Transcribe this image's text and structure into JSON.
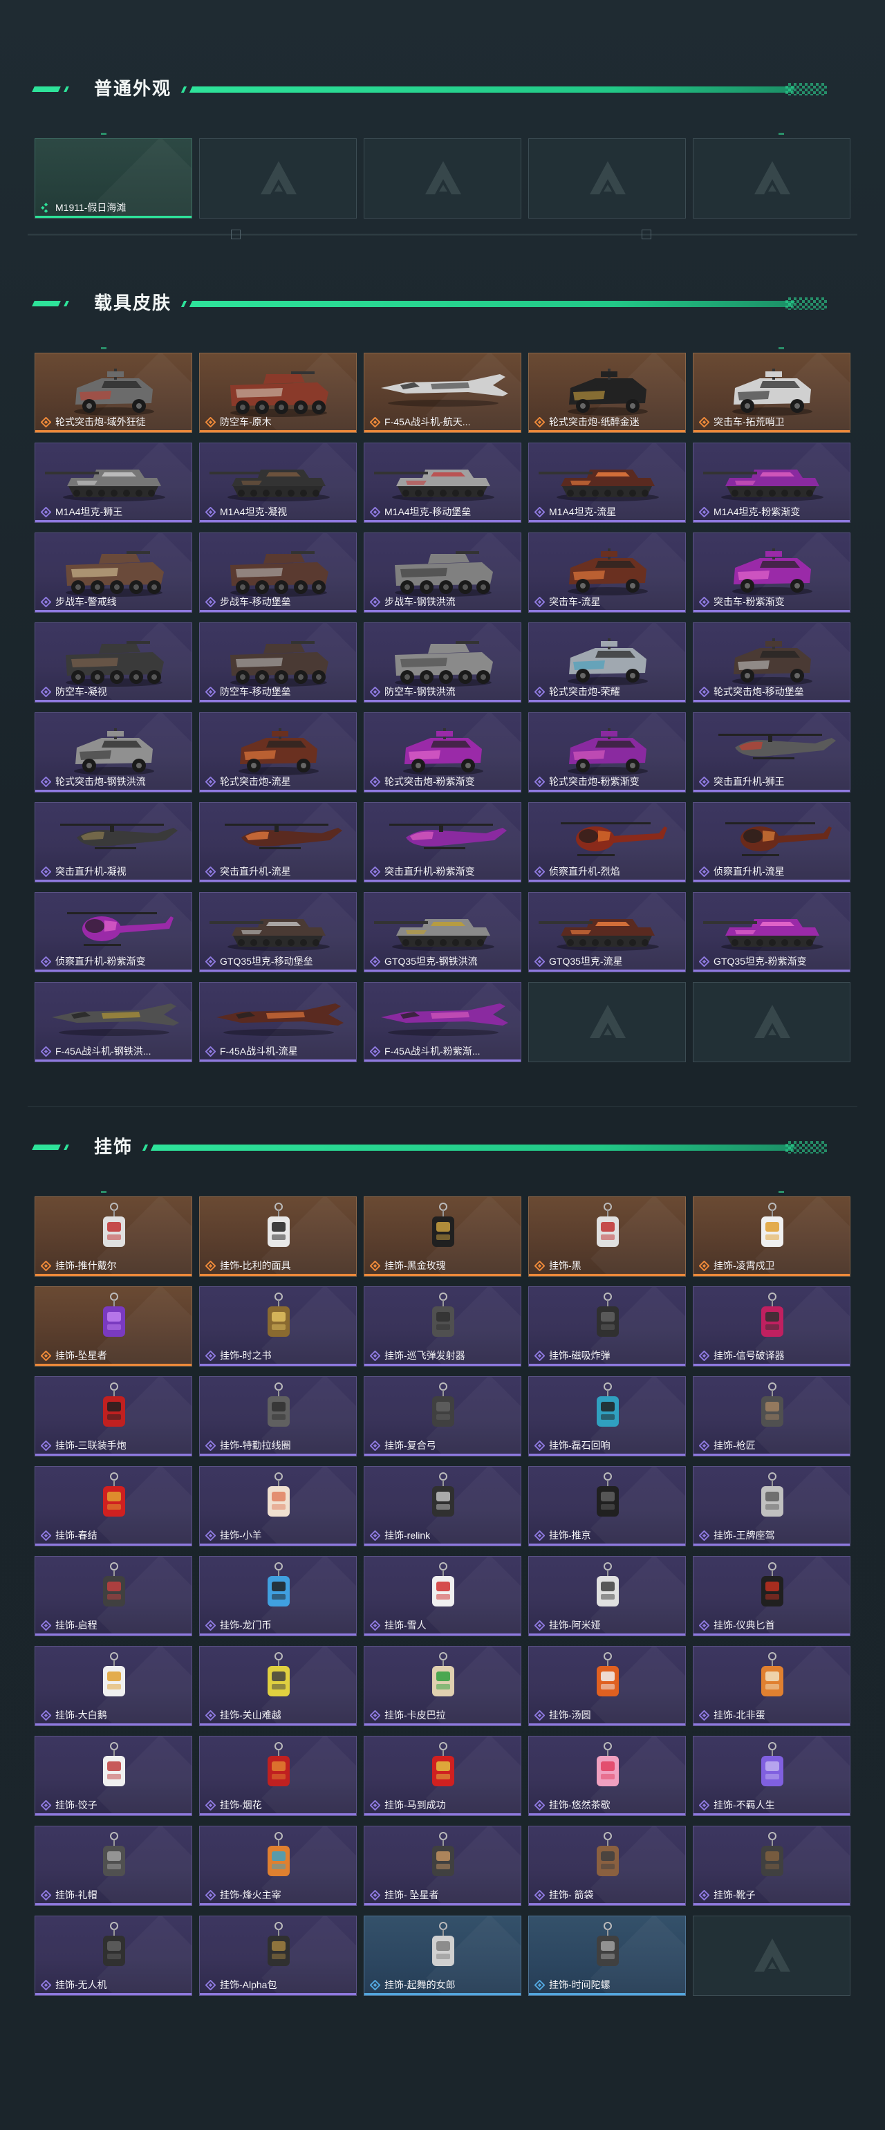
{
  "sections": [
    {
      "title": "普通外观",
      "items": [
        {
          "label": "M1911-假日海滩",
          "rarity": "green",
          "art": "pistol"
        },
        {
          "label": "",
          "rarity": "empty"
        },
        {
          "label": "",
          "rarity": "empty"
        },
        {
          "label": "",
          "rarity": "empty"
        },
        {
          "label": "",
          "rarity": "empty"
        }
      ]
    },
    {
      "title": "载具皮肤",
      "items": [
        {
          "label": "轮式突击炮-域外狂徒",
          "rarity": "orange",
          "art": "armored-car",
          "color": "#6b6b6b",
          "accent": "#c04030"
        },
        {
          "label": "防空车-原木",
          "rarity": "orange",
          "art": "apc",
          "color": "#8a3a2a",
          "accent": "#d8d0c0"
        },
        {
          "label": "F-45A战斗机-航天...",
          "rarity": "orange",
          "art": "jet",
          "color": "#d0d0d0",
          "accent": "#333333"
        },
        {
          "label": "轮式突击炮-纸醉金迷",
          "rarity": "orange",
          "art": "armored-car",
          "color": "#222222",
          "accent": "#c9a040"
        },
        {
          "label": "突击车-拓荒哨卫",
          "rarity": "orange",
          "art": "armored-car",
          "color": "#d0d0d0",
          "accent": "#222222"
        },
        {
          "label": "M1A4坦克-狮王",
          "rarity": "purple",
          "art": "tank",
          "color": "#777777",
          "accent": "#cccccc"
        },
        {
          "label": "M1A4坦克-凝视",
          "rarity": "purple",
          "art": "tank",
          "color": "#333333",
          "accent": "#7a5a40"
        },
        {
          "label": "M1A4坦克-移动堡垒",
          "rarity": "purple",
          "art": "tank",
          "color": "#a0a0a0",
          "accent": "#c04040"
        },
        {
          "label": "M1A4坦克-流星",
          "rarity": "purple",
          "art": "tank",
          "color": "#5a2a20",
          "accent": "#f08040"
        },
        {
          "label": "M1A4坦克-粉紫渐变",
          "rarity": "purple",
          "art": "tank",
          "color": "#8a2aa0",
          "accent": "#e060c0"
        },
        {
          "label": "步战车-警戒线",
          "rarity": "purple",
          "art": "apc",
          "color": "#6a4a3a",
          "accent": "#e0d0a0"
        },
        {
          "label": "步战车-移动堡垒",
          "rarity": "purple",
          "art": "apc",
          "color": "#5a3a30",
          "accent": "#c0c0c0"
        },
        {
          "label": "步战车-钢铁洪流",
          "rarity": "purple",
          "art": "apc",
          "color": "#808080",
          "accent": "#303030"
        },
        {
          "label": "突击车-流星",
          "rarity": "purple",
          "art": "armored-car",
          "color": "#6a3020",
          "accent": "#f08040"
        },
        {
          "label": "突击车-粉紫渐变",
          "rarity": "purple",
          "art": "armored-car",
          "color": "#9a2aa8",
          "accent": "#f070d0"
        },
        {
          "label": "防空车-凝视",
          "rarity": "purple",
          "art": "apc",
          "color": "#3a3a3a",
          "accent": "#8a6a50"
        },
        {
          "label": "防空车-移动堡垒",
          "rarity": "purple",
          "art": "apc",
          "color": "#4a3a34",
          "accent": "#c0c0c0"
        },
        {
          "label": "防空车-钢铁洪流",
          "rarity": "purple",
          "art": "apc",
          "color": "#8a8a8a",
          "accent": "#404040"
        },
        {
          "label": "轮式突击炮-荣耀",
          "rarity": "purple",
          "art": "armored-car",
          "color": "#a0a8b0",
          "accent": "#40a0c0"
        },
        {
          "label": "轮式突击炮-移动堡垒",
          "rarity": "purple",
          "art": "armored-car",
          "color": "#4a3a34",
          "accent": "#c0c0c0"
        },
        {
          "label": "轮式突击炮-钢铁洪流",
          "rarity": "purple",
          "art": "armored-car",
          "color": "#909090",
          "accent": "#303030"
        },
        {
          "label": "轮式突击炮-流星",
          "rarity": "purple",
          "art": "armored-car",
          "color": "#6a3020",
          "accent": "#f08040"
        },
        {
          "label": "轮式突击炮-粉紫渐变",
          "rarity": "purple",
          "art": "armored-car",
          "color": "#9a2aa8",
          "accent": "#f070d0"
        },
        {
          "label": "轮式突击炮-粉紫渐变",
          "rarity": "purple",
          "art": "armored-car",
          "color": "#8a2aa0",
          "accent": "#e060c0"
        },
        {
          "label": "突击直升机-狮王",
          "rarity": "purple",
          "art": "heli",
          "color": "#5a5a5a",
          "accent": "#c04030"
        },
        {
          "label": "突击直升机-凝视",
          "rarity": "purple",
          "art": "heli",
          "color": "#3a3a3a",
          "accent": "#8a7a50"
        },
        {
          "label": "突击直升机-流星",
          "rarity": "purple",
          "art": "heli",
          "color": "#5a2a20",
          "accent": "#f08040"
        },
        {
          "label": "突击直升机-粉紫渐变",
          "rarity": "purple",
          "art": "heli",
          "color": "#8a2aa0",
          "accent": "#e060c0"
        },
        {
          "label": "侦察直升机-烈焰",
          "rarity": "purple",
          "art": "scout-heli",
          "color": "#8a2a1a",
          "accent": "#f08030"
        },
        {
          "label": "侦察直升机-流星",
          "rarity": "purple",
          "art": "scout-heli",
          "color": "#6a2a1a",
          "accent": "#f09040"
        },
        {
          "label": "侦察直升机-粉紫渐变",
          "rarity": "purple",
          "art": "scout-heli",
          "color": "#9a2aa8",
          "accent": "#f070d0"
        },
        {
          "label": "GTQ35坦克-移动堡垒",
          "rarity": "purple",
          "art": "tank",
          "color": "#4a3a34",
          "accent": "#c0c0c0"
        },
        {
          "label": "GTQ35坦克-钢铁洪流",
          "rarity": "purple",
          "art": "tank",
          "color": "#8a8a8a",
          "accent": "#c0a030"
        },
        {
          "label": "GTQ35坦克-流星",
          "rarity": "purple",
          "art": "tank",
          "color": "#5a2a20",
          "accent": "#f08040"
        },
        {
          "label": "GTQ35坦克-粉紫渐变",
          "rarity": "purple",
          "art": "tank",
          "color": "#9a2aa8",
          "accent": "#f070d0"
        },
        {
          "label": "F-45A战斗机-钢铁洪...",
          "rarity": "purple",
          "art": "jet",
          "color": "#505050",
          "accent": "#c0a030"
        },
        {
          "label": "F-45A战斗机-流星",
          "rarity": "purple",
          "art": "jet",
          "color": "#5a2a20",
          "accent": "#f08040"
        },
        {
          "label": "F-45A战斗机-粉紫渐...",
          "rarity": "purple",
          "art": "jet",
          "color": "#8a2aa0",
          "accent": "#e060c0"
        },
        {
          "label": "",
          "rarity": "empty"
        },
        {
          "label": "",
          "rarity": "empty"
        }
      ]
    },
    {
      "title": "挂饰",
      "items": [
        {
          "label": "挂饰-推什戴尔",
          "rarity": "orange",
          "art": "charm",
          "color": "#e0e0e0",
          "accent": "#c03030"
        },
        {
          "label": "挂饰-比利的面具",
          "rarity": "orange",
          "art": "charm",
          "color": "#e8e8e8",
          "accent": "#202020"
        },
        {
          "label": "挂饰-黑金玫瑰",
          "rarity": "orange",
          "art": "charm",
          "color": "#202020",
          "accent": "#c9a040"
        },
        {
          "label": "挂饰-黑",
          "rarity": "orange",
          "art": "charm",
          "color": "#e0e0e0",
          "accent": "#c03030"
        },
        {
          "label": "挂饰-凌霄戍卫",
          "rarity": "orange",
          "art": "charm",
          "color": "#f0f0f0",
          "accent": "#e0a030"
        },
        {
          "label": "挂饰-坠星者",
          "rarity": "orange",
          "art": "charm",
          "color": "#7a3ac0",
          "accent": "#c080f0"
        },
        {
          "label": "挂饰-时之书",
          "rarity": "purple",
          "art": "charm",
          "color": "#8a6a30",
          "accent": "#e0c060"
        },
        {
          "label": "挂饰-巡飞弹发射器",
          "rarity": "purple",
          "art": "charm",
          "color": "#505050",
          "accent": "#303030"
        },
        {
          "label": "挂饰-磁吸炸弹",
          "rarity": "purple",
          "art": "charm",
          "color": "#303030",
          "accent": "#606060"
        },
        {
          "label": "挂饰-信号破译器",
          "rarity": "purple",
          "art": "charm",
          "color": "#c02060",
          "accent": "#303030"
        },
        {
          "label": "挂饰-三联装手炮",
          "rarity": "purple",
          "art": "charm",
          "color": "#c02020",
          "accent": "#202020"
        },
        {
          "label": "挂饰-特勤拉线圈",
          "rarity": "purple",
          "art": "charm",
          "color": "#606060",
          "accent": "#303030"
        },
        {
          "label": "挂饰-复合弓",
          "rarity": "purple",
          "art": "charm",
          "color": "#404040",
          "accent": "#606060"
        },
        {
          "label": "挂饰-磊石回响",
          "rarity": "purple",
          "art": "charm",
          "color": "#30a0c0",
          "accent": "#202020"
        },
        {
          "label": "挂饰-枪匠",
          "rarity": "purple",
          "art": "charm",
          "color": "#505050",
          "accent": "#a08060"
        },
        {
          "label": "挂饰-春结",
          "rarity": "purple",
          "art": "charm",
          "color": "#d02020",
          "accent": "#e0a030"
        },
        {
          "label": "挂饰-小羊",
          "rarity": "purple",
          "art": "charm",
          "color": "#f0e0d0",
          "accent": "#e08060"
        },
        {
          "label": "挂饰-relink",
          "rarity": "purple",
          "art": "charm",
          "color": "#303030",
          "accent": "#c0c0c0"
        },
        {
          "label": "挂饰-推京",
          "rarity": "purple",
          "art": "charm",
          "color": "#202020",
          "accent": "#606060"
        },
        {
          "label": "挂饰-王牌座驾",
          "rarity": "purple",
          "art": "charm",
          "color": "#c0c0c0",
          "accent": "#606060"
        },
        {
          "label": "挂饰-启程",
          "rarity": "purple",
          "art": "charm",
          "color": "#404040",
          "accent": "#c04040"
        },
        {
          "label": "挂饰-龙门币",
          "rarity": "purple",
          "art": "charm",
          "color": "#40a0e0",
          "accent": "#202020"
        },
        {
          "label": "挂饰-雪人",
          "rarity": "purple",
          "art": "charm",
          "color": "#f0f0f0",
          "accent": "#d03030"
        },
        {
          "label": "挂饰-阿米娅",
          "rarity": "purple",
          "art": "charm",
          "color": "#e0e0e0",
          "accent": "#404040"
        },
        {
          "label": "挂饰-仪典匕首",
          "rarity": "purple",
          "art": "charm",
          "color": "#202020",
          "accent": "#c03020"
        },
        {
          "label": "挂饰-大白鹅",
          "rarity": "purple",
          "art": "charm",
          "color": "#f0f0f0",
          "accent": "#e0a030"
        },
        {
          "label": "挂饰-关山难越",
          "rarity": "purple",
          "art": "charm",
          "color": "#e0d040",
          "accent": "#404040"
        },
        {
          "label": "挂饰-卡皮巴拉",
          "rarity": "purple",
          "art": "charm",
          "color": "#e0d0b0",
          "accent": "#30a040"
        },
        {
          "label": "挂饰-汤圆",
          "rarity": "purple",
          "art": "charm",
          "color": "#e06020",
          "accent": "#f0f0f0"
        },
        {
          "label": "挂饰-北非蛋",
          "rarity": "purple",
          "art": "charm",
          "color": "#e08030",
          "accent": "#f0e0c0"
        },
        {
          "label": "挂饰-饺子",
          "rarity": "purple",
          "art": "charm",
          "color": "#f0f0f0",
          "accent": "#c04040"
        },
        {
          "label": "挂饰-烟花",
          "rarity": "purple",
          "art": "charm",
          "color": "#c02020",
          "accent": "#e08030"
        },
        {
          "label": "挂饰-马到成功",
          "rarity": "purple",
          "art": "charm",
          "color": "#d02020",
          "accent": "#e0c040"
        },
        {
          "label": "挂饰-悠然茶歇",
          "rarity": "purple",
          "art": "charm",
          "color": "#f0a0c0",
          "accent": "#e04060"
        },
        {
          "label": "挂饰-不羁人生",
          "rarity": "purple",
          "art": "charm",
          "color": "#8060e0",
          "accent": "#c0b0f0"
        },
        {
          "label": "挂饰-礼帽",
          "rarity": "purple",
          "art": "charm",
          "color": "#505050",
          "accent": "#a0a0a0"
        },
        {
          "label": "挂饰-烽火主宰",
          "rarity": "purple",
          "art": "charm",
          "color": "#e08030",
          "accent": "#40a0c0"
        },
        {
          "label": "挂饰- 坠星者",
          "rarity": "purple",
          "art": "charm",
          "color": "#404040",
          "accent": "#c09060"
        },
        {
          "label": "挂饰- 箭袋",
          "rarity": "purple",
          "art": "charm",
          "color": "#8a6040",
          "accent": "#404040"
        },
        {
          "label": "挂饰-靴子",
          "rarity": "purple",
          "art": "charm",
          "color": "#404040",
          "accent": "#806040"
        },
        {
          "label": "挂饰-无人机",
          "rarity": "purple",
          "art": "charm",
          "color": "#303030",
          "accent": "#606060"
        },
        {
          "label": "挂饰-Alpha包",
          "rarity": "purple",
          "art": "charm",
          "color": "#303030",
          "accent": "#a08040"
        },
        {
          "label": "挂饰-起舞的女郎",
          "rarity": "blue",
          "art": "charm",
          "color": "#d0d0d0",
          "accent": "#808080"
        },
        {
          "label": "挂饰-时间陀螺",
          "rarity": "blue",
          "art": "charm",
          "color": "#404040",
          "accent": "#a0a0a0"
        },
        {
          "label": "",
          "rarity": "empty"
        }
      ]
    }
  ],
  "colors": {
    "accent": "#2ee39a",
    "orange_rarity": "#ef8a3a",
    "purple_rarity": "#8f7ae0",
    "blue_rarity": "#53a7df",
    "green_rarity": "#2ee39a"
  }
}
